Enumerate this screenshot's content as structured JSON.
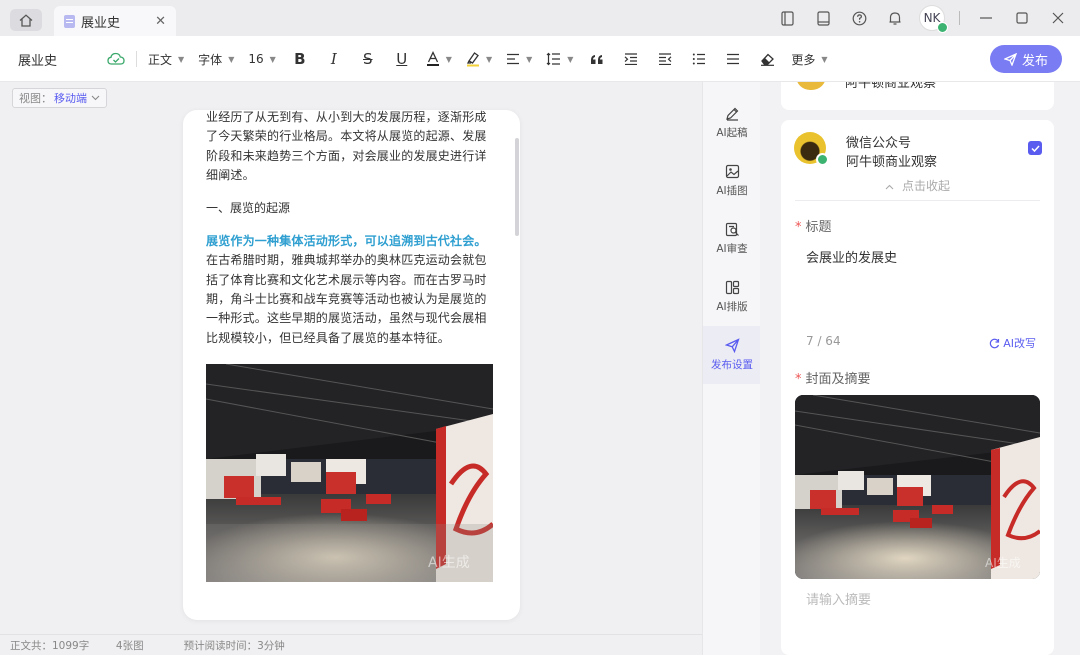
{
  "tab": {
    "title": "展业史"
  },
  "titlebar": {
    "avatar_initials": "NK",
    "icons": [
      "panel-icon",
      "book-icon",
      "help-icon",
      "bell-icon"
    ]
  },
  "toolbar": {
    "doc_name": "展业史",
    "paragraph_style": "正文",
    "font_family": "字体",
    "font_size": "16",
    "more_label": "更多",
    "publish_label": "发布"
  },
  "editor": {
    "view_label": "视图：",
    "view_value": "移动端",
    "para1": "业经历了从无到有、从小到大的发展历程，逐渐形成了今天繁荣的行业格局。本文将从展览的起源、发展阶段和未来趋势三个方面，对会展业的发展史进行详细阐述。",
    "heading1": "一、展览的起源",
    "para2_highlight": "展览作为一种集体活动形式，可以追溯到古代社会。",
    "para2_rest": "在古希腊时期，雅典城邦举办的奥林匹克运动会就包括了体育比赛和文化艺术展示等内容。而在古罗马时期，角斗士比赛和战车竞赛等活动也被认为是展览的一种形式。这些早期的展览活动，虽然与现代会展相比规模较小，但已经具备了展览的基本特征。",
    "image_watermark": "AI生成"
  },
  "statusbar": {
    "word_count": "正文共：1099字",
    "image_count": "4张图",
    "read_time": "预计阅读时间：3分钟"
  },
  "rail": {
    "items": [
      {
        "label": "AI起稿",
        "icon": "pen-icon"
      },
      {
        "label": "AI插图",
        "icon": "image-icon"
      },
      {
        "label": "AI审查",
        "icon": "review-icon"
      },
      {
        "label": "AI排版",
        "icon": "layout-icon"
      },
      {
        "label": "发布设置",
        "icon": "send-icon"
      }
    ]
  },
  "publish_panel": {
    "prev_account_name": "阿牛顿商业观察",
    "account_type": "微信公众号",
    "account_name": "阿牛顿商业观察",
    "collapse_label": "点击收起",
    "title_label": "标题",
    "title_value": "会展业的发展史",
    "title_count": "7 / 64",
    "ai_rewrite_label": "AI改写",
    "cover_label": "封面及摘要",
    "cover_watermark": "AI生成",
    "summary_placeholder": "请输入摘要"
  },
  "colors": {
    "accent": "#5a5cf0",
    "publish_button": "#7a7cf4",
    "highlight_text": "#2e9fd0"
  }
}
